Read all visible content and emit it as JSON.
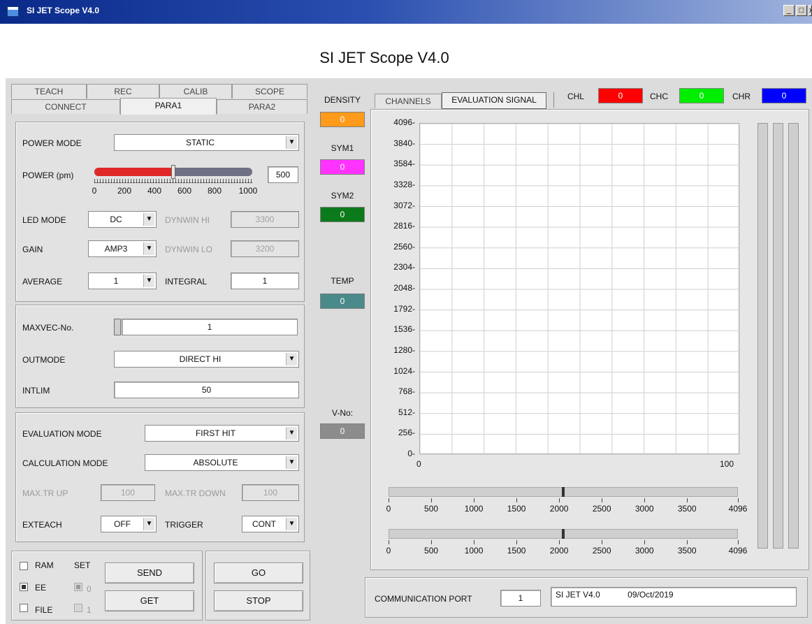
{
  "window": {
    "title": "SI JET Scope V4.0",
    "buttons": [
      "_",
      "□",
      "x"
    ]
  },
  "app_title": "SI JET Scope V4.0",
  "tabs": {
    "row1": [
      "TEACH",
      "REC",
      "CALIB",
      "SCOPE"
    ],
    "row2": [
      "CONNECT",
      "PARA1",
      "PARA2"
    ],
    "active": "PARA1"
  },
  "para1": {
    "power_mode": {
      "label": "POWER MODE",
      "value": "STATIC"
    },
    "power": {
      "label": "POWER (pm)",
      "value": "500",
      "fraction": 0.5,
      "scale": [
        "0",
        "200",
        "400",
        "600",
        "800",
        "1000"
      ]
    },
    "led_mode": {
      "label": "LED MODE",
      "value": "DC"
    },
    "dynwin_hi": {
      "label": "DYNWIN HI",
      "value": "3300"
    },
    "gain": {
      "label": "GAIN",
      "value": "AMP3"
    },
    "dynwin_lo": {
      "label": "DYNWIN LO",
      "value": "3200"
    },
    "average": {
      "label": "AVERAGE",
      "value": "1"
    },
    "integral": {
      "label": "INTEGRAL",
      "value": "1"
    }
  },
  "vec": {
    "maxvec": {
      "label": "MAXVEC-No.",
      "value": "1"
    },
    "outmode": {
      "label": "OUTMODE",
      "value": "DIRECT HI"
    },
    "intlim": {
      "label": "INTLIM",
      "value": "50"
    }
  },
  "eval": {
    "evaluation_mode": {
      "label": "EVALUATION MODE",
      "value": "FIRST HIT"
    },
    "calculation_mode": {
      "label": "CALCULATION MODE",
      "value": "ABSOLUTE"
    },
    "max_tr_up": {
      "label": "MAX.TR UP",
      "value": "100"
    },
    "max_tr_down": {
      "label": "MAX.TR DOWN",
      "value": "100"
    },
    "exteach": {
      "label": "EXTEACH",
      "value": "OFF"
    },
    "trigger": {
      "label": "TRIGGER",
      "value": "CONT"
    }
  },
  "storage": {
    "ram": "RAM",
    "ee": "EE",
    "file": "FILE",
    "set": "SET",
    "set0": "0",
    "set1": "1",
    "ee_checked": true,
    "set0_checked": true
  },
  "actions": {
    "send": "SEND",
    "get": "GET",
    "go": "GO",
    "stop": "STOP"
  },
  "indicators": {
    "density": {
      "label": "DENSITY",
      "value": "0",
      "color": "#ff9a1a"
    },
    "sym1": {
      "label": "SYM1",
      "value": "0",
      "color": "#ff33ff"
    },
    "sym2": {
      "label": "SYM2",
      "value": "0",
      "color": "#0a7a1a"
    },
    "temp": {
      "label": "TEMP",
      "value": "0",
      "color": "#4a8a8a"
    },
    "vno": {
      "label": "V-No:",
      "value": "0",
      "color": "#8c8c8c"
    }
  },
  "chart_tabs": [
    "CHANNELS",
    "EVALUATION SIGNAL"
  ],
  "channels": {
    "chl": {
      "label": "CHL",
      "value": "0",
      "color": "#ff0000"
    },
    "chc": {
      "label": "CHC",
      "value": "0",
      "color": "#00ee00"
    },
    "chr": {
      "label": "CHR",
      "value": "0",
      "color": "#0000ff"
    }
  },
  "chart_data": {
    "type": "line",
    "yticks": [
      "4096",
      "3840",
      "3584",
      "3328",
      "3072",
      "2816",
      "2560",
      "2304",
      "2048",
      "1792",
      "1536",
      "1280",
      "1024",
      "768",
      "512",
      "256",
      "0"
    ],
    "ylim": [
      0,
      4096
    ],
    "xlim": [
      0,
      100
    ],
    "xticks": [
      "0",
      "100"
    ],
    "grid": true,
    "series": []
  },
  "sliders": {
    "ticks": [
      "0",
      "500",
      "1000",
      "1500",
      "2000",
      "2500",
      "3000",
      "3500",
      "4096"
    ],
    "upper_value": 2048,
    "lower_value": 2048,
    "max": 4096
  },
  "comm": {
    "label": "COMMUNICATION PORT",
    "port": "1",
    "info_name": "SI JET V4.0",
    "info_date": "09/Oct/2019"
  }
}
